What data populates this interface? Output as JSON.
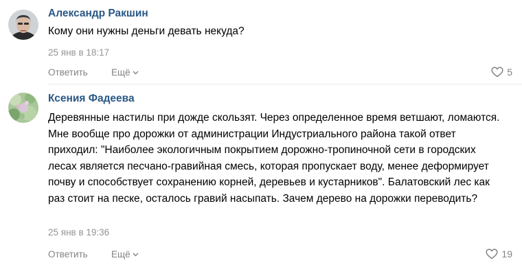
{
  "comments": [
    {
      "author": "Александр Ракшин",
      "text": "Кому они нужны деньги девать некуда?",
      "date": "25 янв в 18:17",
      "reply_label": "Ответить",
      "more_label": "Ещё",
      "likes": "5"
    },
    {
      "author": "Ксения Фадеева",
      "text": "Деревянные настилы при дожде скользят. Через определенное время ветшают, ломаются. Мне вообще про дорожки от администрации Индустриального района такой ответ приходил: \"Наиболее экологичным покрытием дорожно-тропиночной сети в городских лесах является песчано-гравийная смесь, которая пропускает воду, менее деформирует почву и способствует сохранению корней, деревьев и кустарников\". Балатовский лес как раз стоит на песке, осталось гравий насыпать. Зачем дерево на дорожки переводить?",
      "date": "25 янв в 19:36",
      "reply_label": "Ответить",
      "more_label": "Ещё",
      "likes": "19"
    }
  ],
  "icons": {
    "like": "heart-outline-icon",
    "more": "chevron-down-icon"
  },
  "colors": {
    "author": "#2a5885",
    "meta": "#939393",
    "action": "#828282"
  }
}
